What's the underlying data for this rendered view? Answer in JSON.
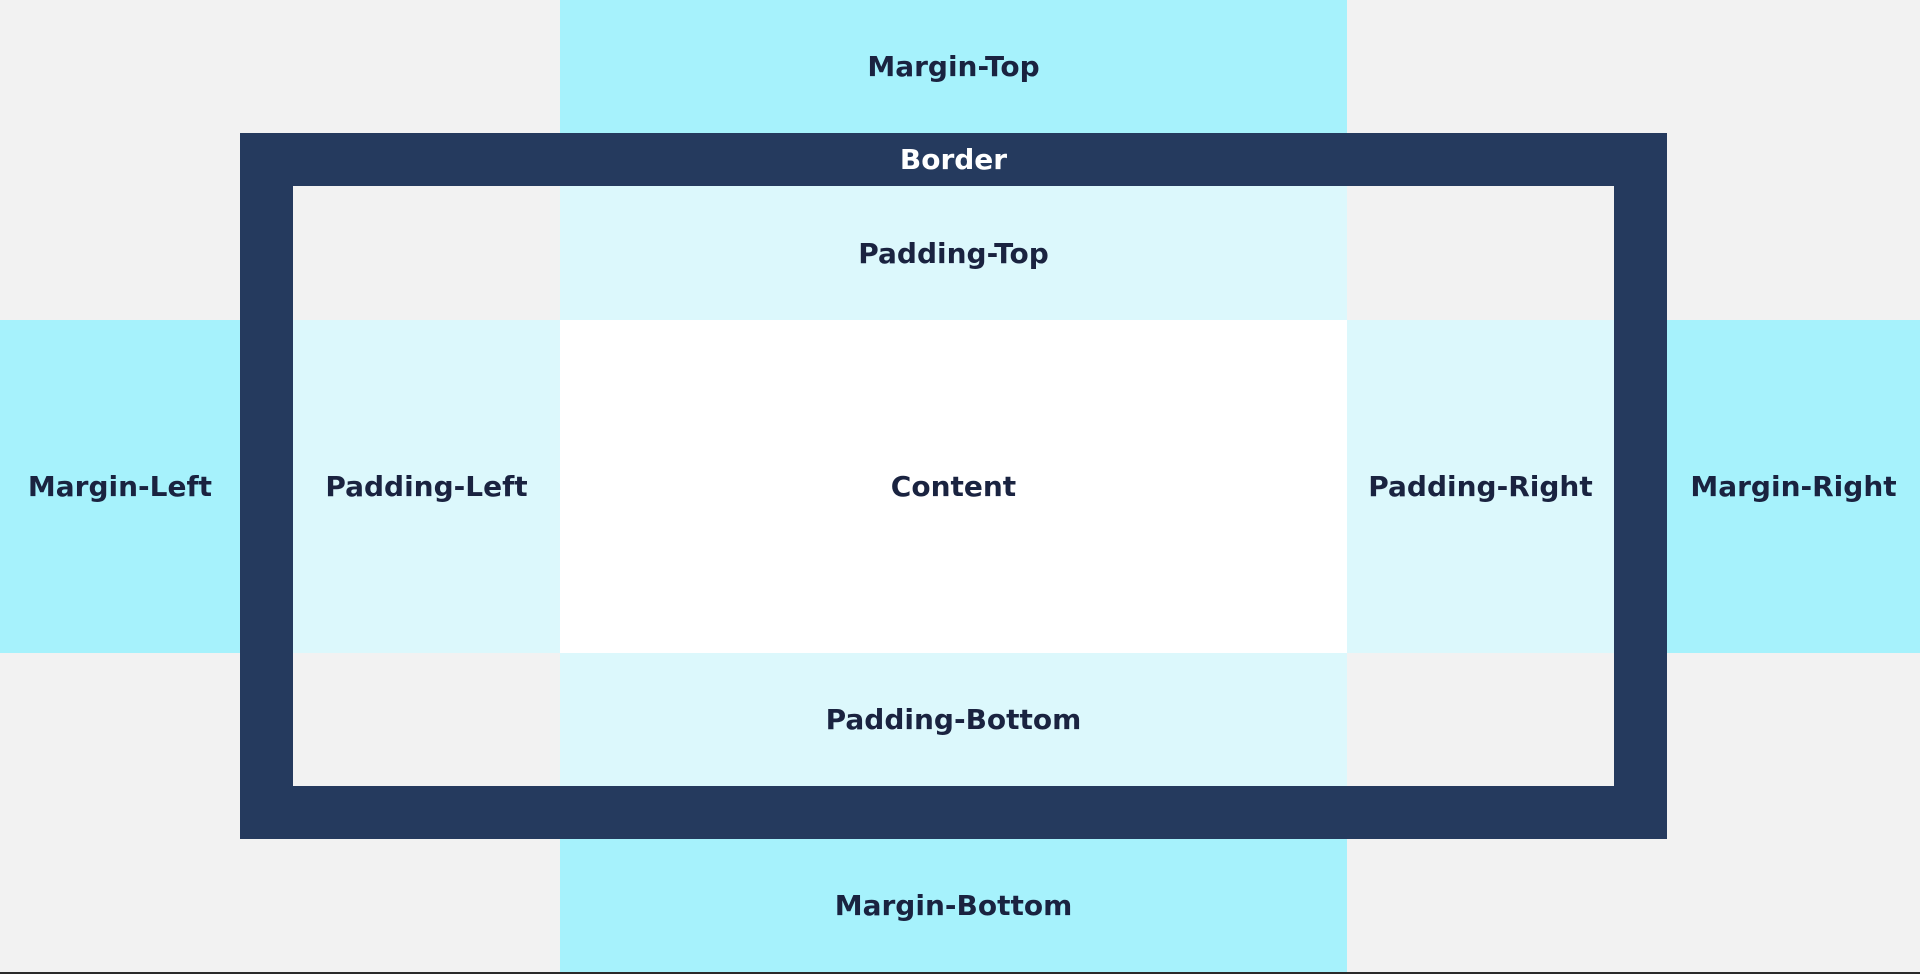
{
  "colors": {
    "background": "#f2f2f2",
    "margin": "#a6f2fc",
    "border": "#253a5e",
    "padding": "#dcf8fc",
    "content": "#ffffff",
    "dark_text": "#1a2340",
    "light_text": "#ffffff"
  },
  "labels": {
    "margin_top": "Margin-Top",
    "margin_bottom": "Margin-Bottom",
    "margin_left": "Margin-Left",
    "margin_right": "Margin-Right",
    "border": "Border",
    "padding_top": "Padding-Top",
    "padding_bottom": "Padding-Bottom",
    "padding_left": "Padding-Left",
    "padding_right": "Padding-Right",
    "content": "Content"
  }
}
